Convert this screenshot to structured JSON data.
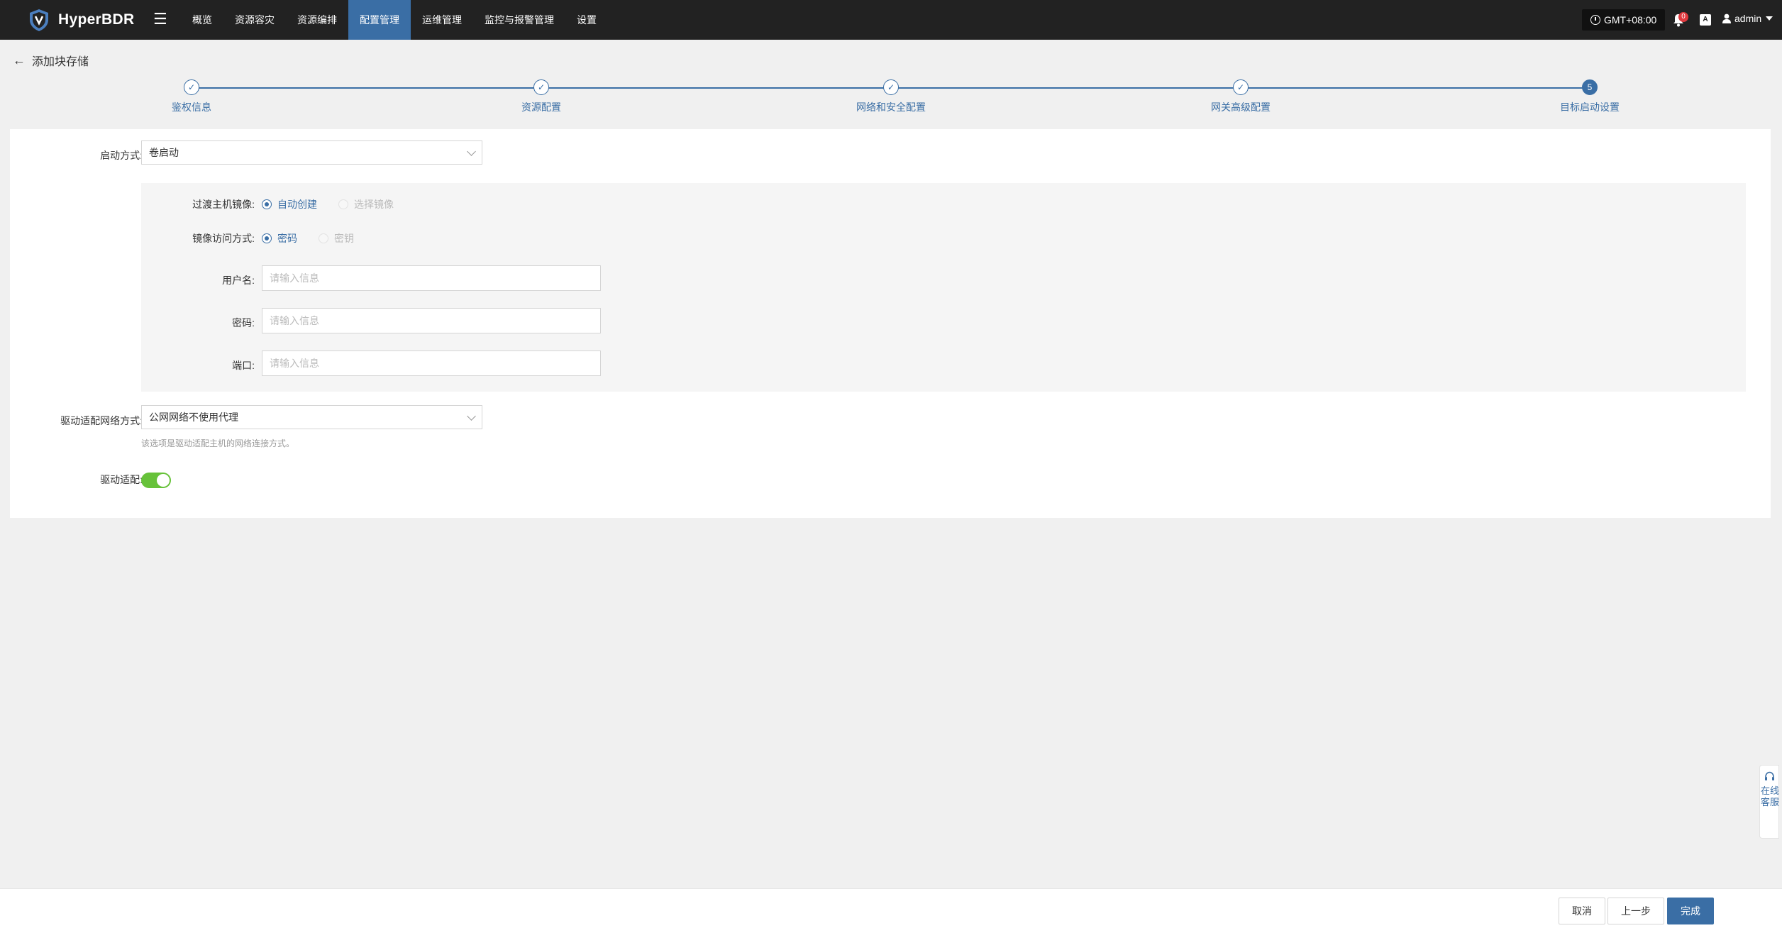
{
  "app": {
    "name": "HyperBDR"
  },
  "nav": {
    "items": [
      "概览",
      "资源容灾",
      "资源编排",
      "配置管理",
      "运维管理",
      "监控与报警管理",
      "设置"
    ],
    "active_index": 3
  },
  "header": {
    "timezone": "GMT+08:00",
    "notification_count": "0",
    "language_icon": "A",
    "user": "admin"
  },
  "page": {
    "title": "添加块存储"
  },
  "steps": {
    "items": [
      "鉴权信息",
      "资源配置",
      "网络和安全配置",
      "网关高级配置",
      "目标启动设置"
    ],
    "current_number": "5",
    "completed_count": 4
  },
  "form": {
    "boot_mode": {
      "label": "启动方式:",
      "value": "卷启动"
    },
    "transition_image": {
      "label": "过渡主机镜像:",
      "options": [
        "自动创建",
        "选择镜像"
      ],
      "selected": "自动创建"
    },
    "image_access": {
      "label": "镜像访问方式:",
      "options": [
        "密码",
        "密钥"
      ],
      "selected": "密码"
    },
    "username": {
      "label": "用户名:",
      "placeholder": "请输入信息"
    },
    "password": {
      "label": "密码:",
      "placeholder": "请输入信息"
    },
    "port": {
      "label": "端口:",
      "placeholder": "请输入信息"
    },
    "driver_network": {
      "label": "驱动适配网络方式:",
      "value": "公网网络不使用代理",
      "hint": "该选项是驱动适配主机的网络连接方式。"
    },
    "driver_adapt": {
      "label": "驱动适配:",
      "enabled": true
    }
  },
  "footer": {
    "cancel": "取消",
    "prev": "上一步",
    "finish": "完成"
  },
  "chat": {
    "label": "在线客服"
  },
  "colors": {
    "nav_bg": "#222222",
    "accent": "#3a6ea5",
    "toggle_on": "#67c23a"
  }
}
